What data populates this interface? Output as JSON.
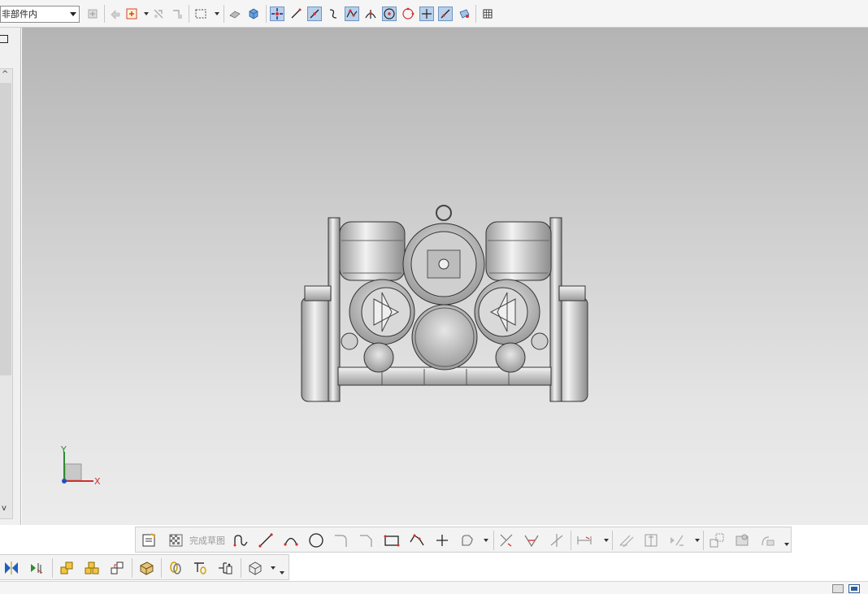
{
  "top_toolbar": {
    "selection_filter": "非部件内",
    "icons": [
      "wcs-icon",
      "undo-arrow-icon",
      "snap-add-icon",
      "snap-move-icon",
      "snap-edit-icon",
      "rectangle-select-icon",
      "shaded-view-icon",
      "cube-view-icon",
      "snap-endpoint-icon",
      "snap-line-icon",
      "snap-midline-icon",
      "snap-curve-icon",
      "snap-control-icon",
      "snap-intersection-icon",
      "snap-center-icon",
      "snap-quadrant-icon",
      "snap-point-icon",
      "snap-on-curve-icon",
      "snap-face-icon",
      "grid-icon"
    ]
  },
  "viewport": {
    "axis": {
      "y_label": "Y",
      "x_label": "X"
    }
  },
  "bottom_toolbar_1": {
    "finish_sketch_label": "完成草图"
  },
  "colors": {
    "viewport_top": "#b4b4b4",
    "viewport_bottom": "#ececec",
    "active_tool": "#b8d0ea",
    "axis_y": "#2e8b2e",
    "axis_x": "#d03030",
    "axis_z": "#2050c0"
  }
}
